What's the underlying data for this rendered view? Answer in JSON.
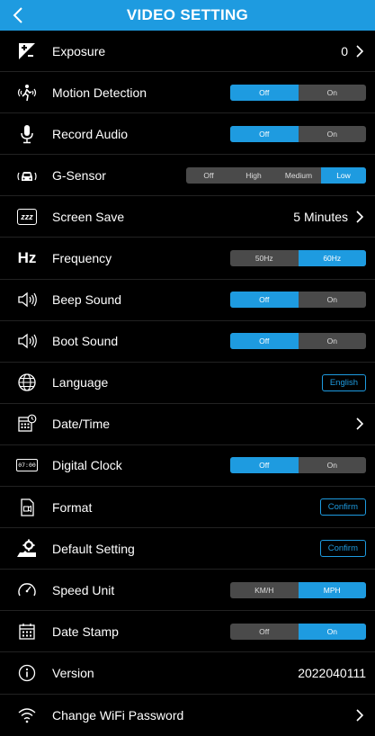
{
  "header": {
    "title": "VIDEO SETTING"
  },
  "rows": {
    "exposure": {
      "label": "Exposure",
      "value": "0"
    },
    "motion": {
      "label": "Motion Detection",
      "options": [
        "Off",
        "On"
      ],
      "selected": "Off"
    },
    "audio": {
      "label": "Record Audio",
      "options": [
        "Off",
        "On"
      ],
      "selected": "Off"
    },
    "gsensor": {
      "label": "G-Sensor",
      "options": [
        "Off",
        "High",
        "Medium",
        "Low"
      ],
      "selected": "Low"
    },
    "screensave": {
      "label": "Screen Save",
      "value": "5 Minutes"
    },
    "frequency": {
      "label": "Frequency",
      "options": [
        "50Hz",
        "60Hz"
      ],
      "selected": "60Hz"
    },
    "beep": {
      "label": "Beep Sound",
      "options": [
        "Off",
        "On"
      ],
      "selected": "Off"
    },
    "boot": {
      "label": "Boot Sound",
      "options": [
        "Off",
        "On"
      ],
      "selected": "Off"
    },
    "language": {
      "label": "Language",
      "value": "English"
    },
    "datetime": {
      "label": "Date/Time"
    },
    "clock": {
      "label": "Digital Clock",
      "options": [
        "Off",
        "On"
      ],
      "selected": "Off"
    },
    "format": {
      "label": "Format",
      "button": "Confirm"
    },
    "default": {
      "label": "Default Setting",
      "button": "Confirm"
    },
    "speed": {
      "label": "Speed Unit",
      "options": [
        "KM/H",
        "MPH"
      ],
      "selected": "MPH"
    },
    "datestamp": {
      "label": "Date Stamp",
      "options": [
        "Off",
        "On"
      ],
      "selected": "On"
    },
    "version": {
      "label": "Version",
      "value": "2022040111"
    },
    "wifi": {
      "label": "Change WiFi Password"
    }
  },
  "icons": {
    "back": "chevron-left-icon",
    "exposure": "exposure-icon",
    "motion": "motion-icon",
    "audio": "microphone-icon",
    "gsensor": "car-sensor-icon",
    "screensave": "zzz-icon",
    "frequency": "hz-icon",
    "beep": "speaker-icon",
    "boot": "speaker-icon",
    "language": "globe-icon",
    "datetime": "calendar-clock-icon",
    "clock": "digital-clock-icon",
    "format": "format-icon",
    "default": "reset-icon",
    "speed": "speedometer-icon",
    "datestamp": "calendar-icon",
    "version": "info-icon",
    "wifi": "wifi-icon"
  },
  "icon_text": {
    "zzz": "zzz",
    "hz": "Hz",
    "clock": "07:00"
  },
  "colors": {
    "accent": "#1e9be0",
    "background": "#000000",
    "segment_bg": "#4a4a4a"
  }
}
